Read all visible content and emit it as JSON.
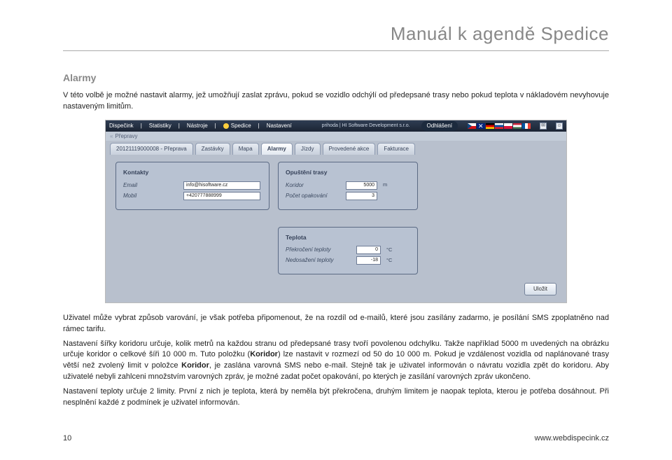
{
  "doc": {
    "title": "Manuál k agendě Spedice",
    "section": "Alarmy",
    "p1": "V této volbě je možné nastavit alarmy, jež umožňují zaslat zprávu, pokud se vozidlo odchýlí od předepsané trasy nebo pokud teplota v nákladovém nevyhovuje nastaveným limitům.",
    "p2": "Uživatel může vybrat způsob varování, je však potřeba připomenout, že na rozdíl od e-mailů, které jsou zasílány zadarmo, je posílání SMS zpoplatněno nad rámec tarifu.",
    "p3a": "Nastavení šířky koridoru určuje, kolik metrů na každou stranu od předepsané trasy tvoří povolenou odchylku. Takže například 5000 m uvedených na obrázku určuje koridor o celkové šíři 10 000 m. Tuto položku (",
    "p3b": ") lze nastavit v rozmezí od 50 do 10 000 m. Pokud je vzdálenost vozidla od naplánované trasy větší než zvolený limit v položce ",
    "p3c": ", je zaslána varovná SMS nebo e-mail. Stejně tak je uživatel informován o návratu vozidla zpět do koridoru. Aby uživatelé nebyli zahlceni množstvím varovných zpráv, je možné zadat počet opakování, po kterých je zasílání varovných zpráv ukončeno.",
    "p4": "Nastavení teploty určuje 2 limity. První z nich je teplota, která by neměla být překročena, druhým limitem je naopak teplota, kterou je potřeba dosáhnout. Při nesplnění každé z podmínek je uživatel informován.",
    "koridor_bold": "Koridor",
    "page_number": "10",
    "site": "www.webdispecink.cz"
  },
  "ui": {
    "menu": [
      "Dispečink",
      "Statistiky",
      "Nástroje",
      "Spedice",
      "Nastavení"
    ],
    "status": "prihoda | HI Software Development s.r.o.",
    "logout": "Odhlášení",
    "breadcrumb": "Přepravy",
    "tabs": [
      "20121119000008 - Přeprava",
      "Zastávky",
      "Mapa",
      "Alarmy",
      "Jízdy",
      "Provedené akce",
      "Fakturace"
    ],
    "active_tab_index": 3,
    "panels": {
      "kontakty": {
        "title": "Kontakty",
        "email_label": "Email",
        "email_value": "info@hisoftware.cz",
        "mobil_label": "Mobil",
        "mobil_value": "+420777888999"
      },
      "opusteni": {
        "title": "Opuštění trasy",
        "koridor_label": "Koridor",
        "koridor_value": "5000",
        "koridor_unit": "m",
        "pocet_label": "Počet opakování",
        "pocet_value": "3"
      },
      "teplota": {
        "title": "Teplota",
        "prekroceni_label": "Překročení teploty",
        "prekroceni_value": "0",
        "nedosazeni_label": "Nedosažení teploty",
        "nedosazeni_value": "-18",
        "unit": "°C"
      }
    },
    "save": "Uložit"
  }
}
